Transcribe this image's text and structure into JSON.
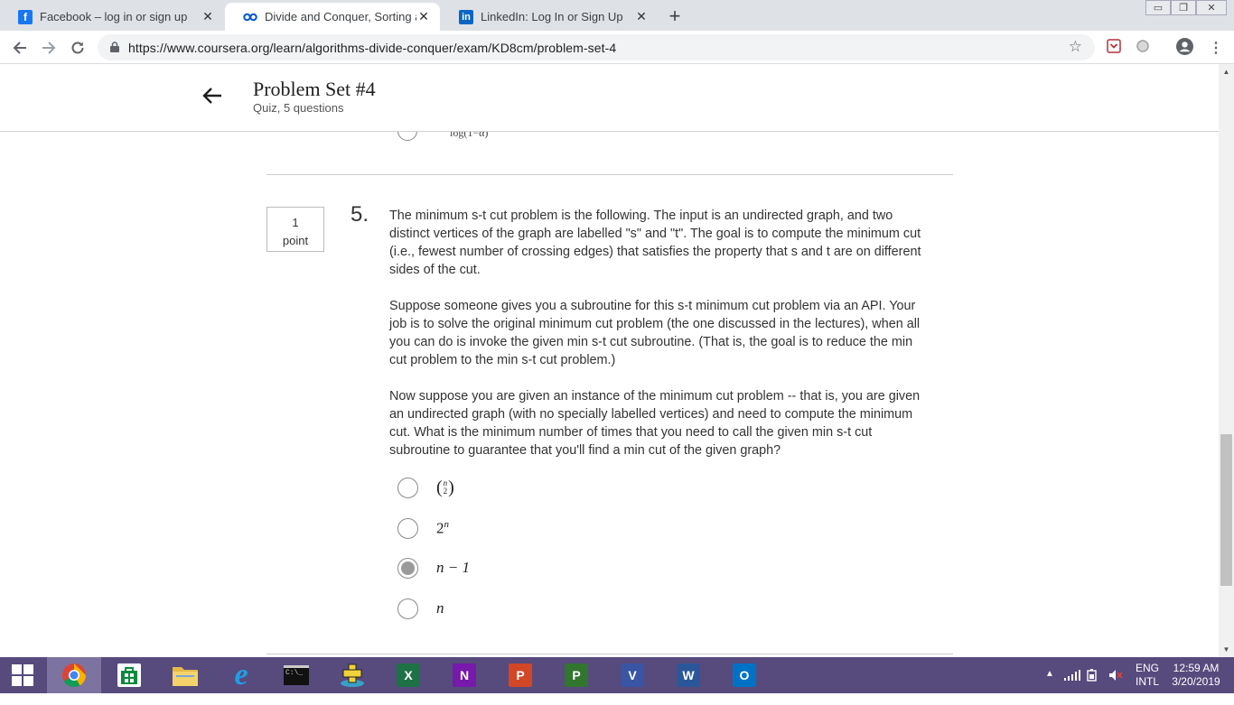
{
  "browser": {
    "tabs": [
      {
        "title": "Facebook – log in or sign up",
        "icon": "facebook-icon",
        "active": false
      },
      {
        "title": "Divide and Conquer, Sorting and Searching",
        "icon": "coursera-icon",
        "active": true
      },
      {
        "title": "LinkedIn: Log In or Sign Up",
        "icon": "linkedin-icon",
        "active": false
      }
    ],
    "url": "https://www.coursera.org/learn/algorithms-divide-conquer/exam/KD8cm/problem-set-4"
  },
  "header": {
    "title": "Problem Set #4",
    "subtitle": "Quiz, 5 questions"
  },
  "previous_question": {
    "option_fragment": "log(1−α)"
  },
  "question": {
    "points_value": "1",
    "points_unit": "point",
    "number": "5.",
    "paragraphs": [
      "The minimum s-t cut problem is the following. The input is an undirected graph, and two distinct vertices of the graph are labelled \"s\" and \"t\". The goal is to compute the minimum cut (i.e., fewest number of crossing edges) that satisfies the property that s and t are on different sides of the cut.",
      "Suppose someone gives you a subroutine for this s-t minimum cut problem via an API. Your job is to solve the original minimum cut problem (the one discussed in the lectures), when all you can do is invoke the given min s-t cut subroutine. (That is, the goal is to reduce the min cut problem to the min s-t cut problem.)",
      "Now suppose you are given an instance of the minimum cut problem -- that is, you are given an undirected graph (with no specially labelled vertices) and need to compute the minimum cut. What is the minimum number of times that you need to call the given min s-t cut subroutine to guarantee that you'll find a min cut of the given graph?"
    ],
    "options": {
      "binom_top": "n",
      "binom_bottom": "2",
      "pow_base": "2",
      "pow_exp": "n",
      "n_minus_one": "n − 1",
      "n": "n"
    },
    "selected_option": "n − 1"
  },
  "taskbar": {
    "apps": [
      "windows-start",
      "chrome",
      "store",
      "file-explorer",
      "internet-explorer",
      "command-prompt",
      "plus-app",
      "excel",
      "onenote",
      "powerpoint",
      "project",
      "visio",
      "word",
      "outlook"
    ],
    "language_top": "ENG",
    "language_bottom": "INTL",
    "time": "12:59 AM",
    "date": "3/20/2019"
  },
  "colors": {
    "taskbar": "#574a7d",
    "facebook": "#1877f2",
    "linkedin": "#0a66c2",
    "coursera": "#0056d2",
    "excel": "#1e7145",
    "onenote": "#7719aa",
    "powerpoint": "#d24726",
    "project": "#31752f",
    "visio": "#3955a3",
    "word": "#2b579a",
    "outlook": "#0072c6"
  }
}
